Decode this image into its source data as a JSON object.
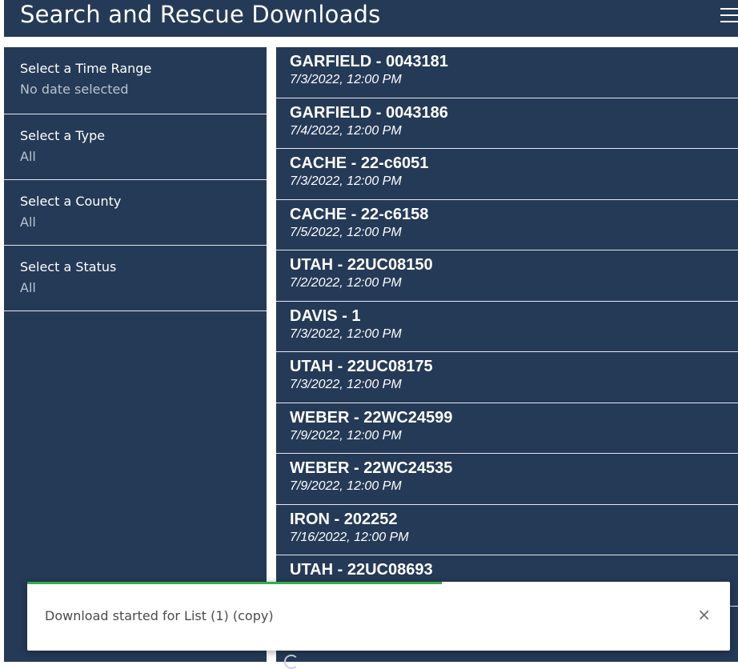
{
  "header": {
    "title": "Search and Rescue Downloads",
    "menu_icon": "hamburger-menu-icon"
  },
  "filters": [
    {
      "label": "Select a Time Range",
      "value": "No date selected"
    },
    {
      "label": "Select a Type",
      "value": "All"
    },
    {
      "label": "Select a County",
      "value": "All"
    },
    {
      "label": "Select a Status",
      "value": "All"
    }
  ],
  "items": [
    {
      "title": "GARFIELD - 0043181",
      "date": "7/3/2022, 12:00 PM"
    },
    {
      "title": "GARFIELD - 0043186",
      "date": "7/4/2022, 12:00 PM"
    },
    {
      "title": "CACHE - 22-c6051",
      "date": "7/3/2022, 12:00 PM"
    },
    {
      "title": "CACHE - 22-c6158",
      "date": "7/5/2022, 12:00 PM"
    },
    {
      "title": "UTAH - 22UC08150",
      "date": "7/2/2022, 12:00 PM"
    },
    {
      "title": "DAVIS - 1",
      "date": "7/3/2022, 12:00 PM"
    },
    {
      "title": "UTAH - 22UC08175",
      "date": "7/3/2022, 12:00 PM"
    },
    {
      "title": "WEBER - 22WC24599",
      "date": "7/9/2022, 12:00 PM"
    },
    {
      "title": "WEBER - 22WC24535",
      "date": "7/9/2022, 12:00 PM"
    },
    {
      "title": "IRON - 202252",
      "date": "7/16/2022, 12:00 PM"
    },
    {
      "title": "UTAH - 22UC08693",
      "date": ""
    }
  ],
  "toast": {
    "message": "Download started for List (1) (copy)",
    "close": "×",
    "progress": 0.59
  },
  "colors": {
    "panel": "#253a57",
    "progress": "#35ac46"
  }
}
